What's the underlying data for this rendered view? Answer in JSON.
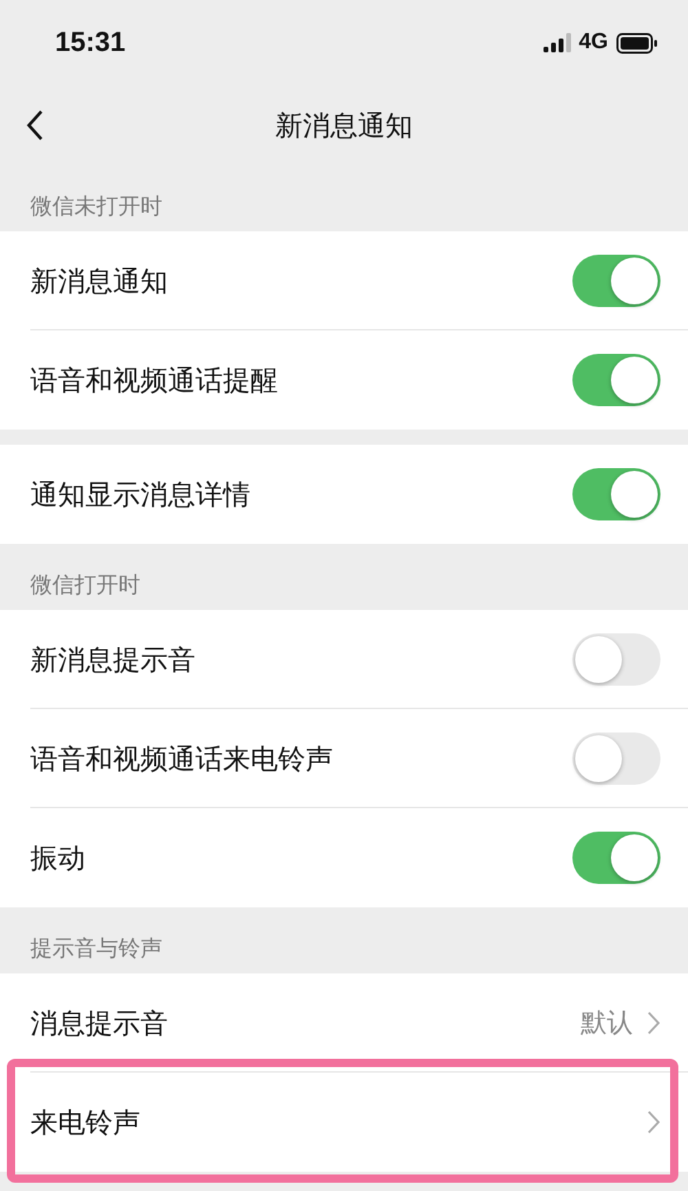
{
  "status_bar": {
    "time": "15:31",
    "network": "4G"
  },
  "nav": {
    "title": "新消息通知"
  },
  "groups": [
    {
      "header": "微信未打开时",
      "rows": [
        {
          "kind": "toggle",
          "label": "新消息通知",
          "on": true,
          "highlighted": false
        },
        {
          "kind": "toggle",
          "label": "语音和视频通话提醒",
          "on": true,
          "highlighted": false
        }
      ]
    },
    {
      "rows": [
        {
          "kind": "toggle",
          "label": "通知显示消息详情",
          "on": true,
          "highlighted": false
        }
      ]
    },
    {
      "header": "微信打开时",
      "rows": [
        {
          "kind": "toggle",
          "label": "新消息提示音",
          "on": false,
          "highlighted": false
        },
        {
          "kind": "toggle",
          "label": "语音和视频通话来电铃声",
          "on": false,
          "highlighted": false
        },
        {
          "kind": "toggle",
          "label": "振动",
          "on": true,
          "highlighted": false
        }
      ]
    },
    {
      "header": "提示音与铃声",
      "rows": [
        {
          "kind": "link",
          "label": "消息提示音",
          "value": "默认",
          "highlighted": false
        },
        {
          "kind": "link",
          "label": "来电铃声",
          "highlighted": true
        }
      ]
    }
  ]
}
